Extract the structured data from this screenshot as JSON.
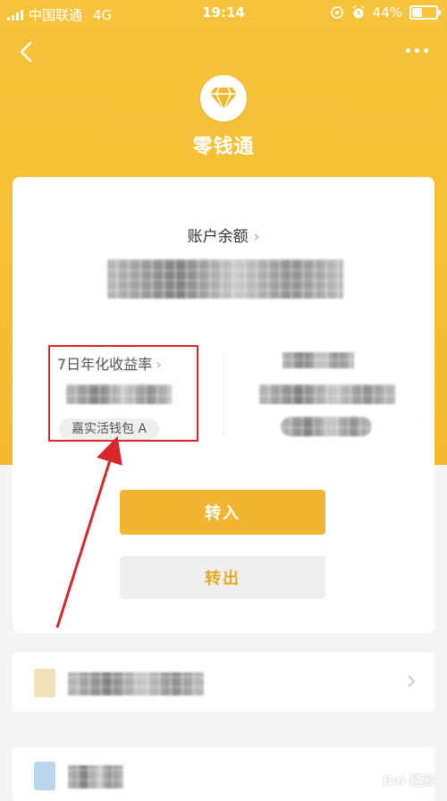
{
  "status_bar": {
    "carrier": "中国联通",
    "network": "4G",
    "time": "19:14",
    "battery": "44%",
    "battery_level": 0.44
  },
  "nav": {
    "back_icon": "chevron-left-icon",
    "more_icon": "more-dots-icon"
  },
  "brand": {
    "icon": "diamond-icon",
    "title": "零钱通"
  },
  "balance": {
    "label": "账户余额",
    "chevron": "›"
  },
  "yield": {
    "label": "7日年化收益率",
    "chevron": "›",
    "fund_name": "嘉实活钱包 A"
  },
  "actions": {
    "transfer_in": "转入",
    "transfer_out": "转出"
  },
  "watermark": "Bai 经验",
  "colors": {
    "brand_yellow": "#f7c33a",
    "button_yellow": "#f1b532",
    "annotation_red": "#d8262b"
  }
}
